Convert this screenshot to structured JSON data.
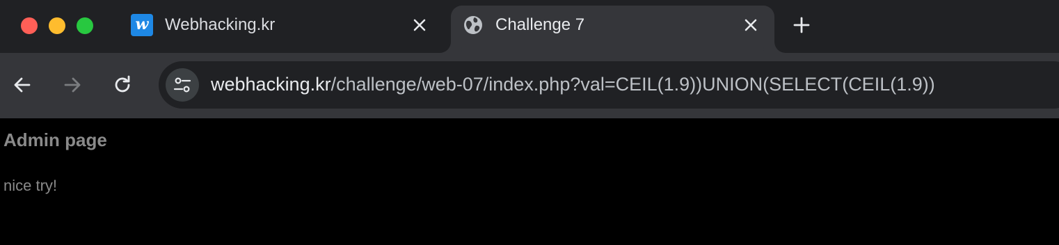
{
  "window": {
    "controls": [
      "close",
      "minimize",
      "maximize"
    ]
  },
  "tabs": [
    {
      "title": "Webhacking.kr",
      "favicon": "w-logo",
      "favicon_letter": "w",
      "active": false,
      "favicon_color": "#1e88e5"
    },
    {
      "title": "Challenge 7",
      "favicon": "globe-icon",
      "active": true
    }
  ],
  "toolbar": {
    "url_host": "webhacking.kr",
    "url_path": "/challenge/web-07/index.php?val=CEIL(1.9))UNION(SELECT(CEIL(1.9))"
  },
  "page": {
    "heading": "Admin page",
    "message": "nice try!"
  },
  "colors": {
    "tabstrip_bg": "#202124",
    "toolbar_bg": "#35363a",
    "omnibox_bg": "#202124",
    "page_bg": "#000000",
    "page_text": "#8a8a8a"
  }
}
